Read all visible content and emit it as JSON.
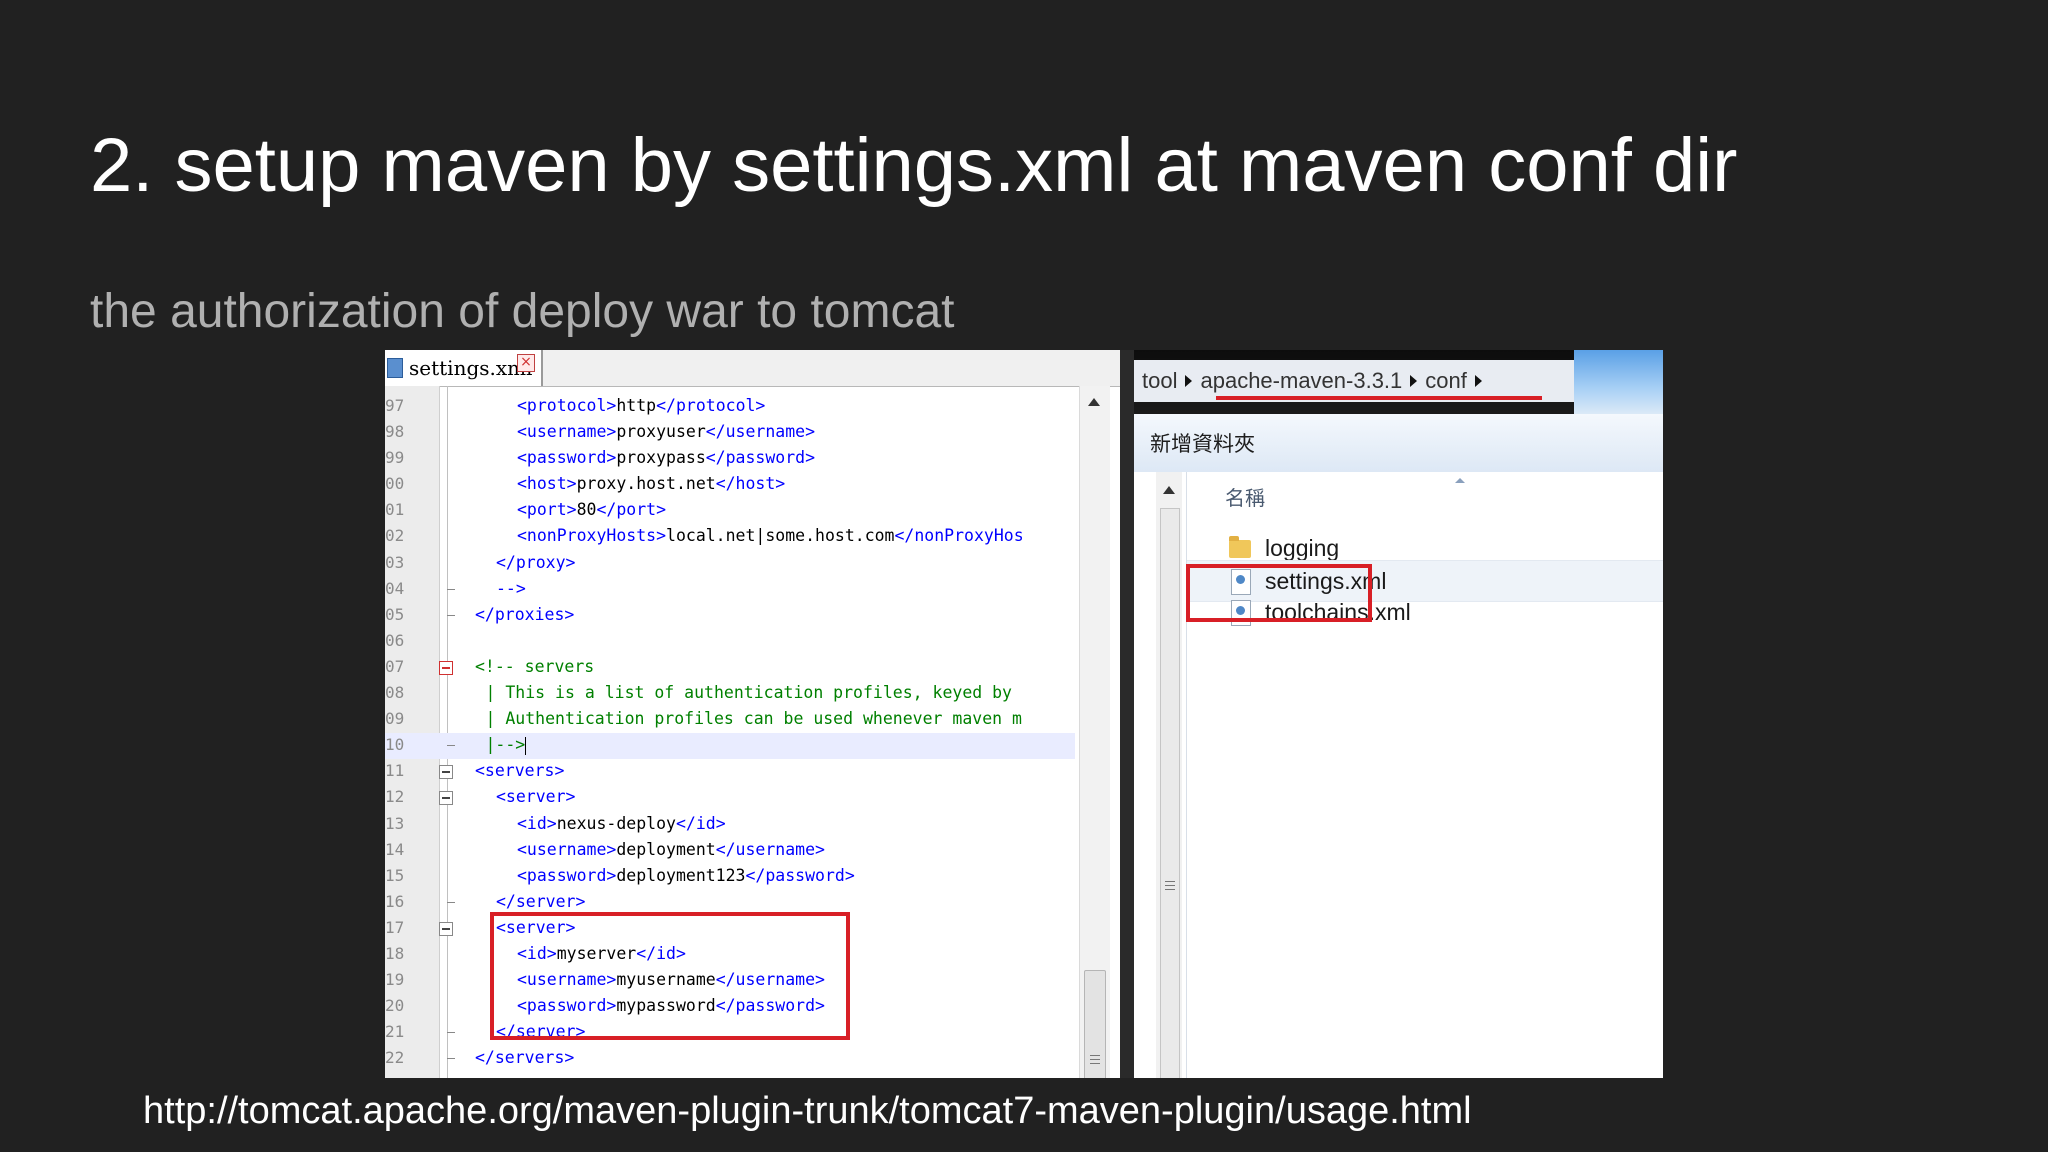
{
  "slide": {
    "title": "2. setup maven by settings.xml at maven conf dir",
    "subtitle": "the authorization of deploy war to tomcat",
    "footer_url": "http://tomcat.apache.org/maven-plugin-trunk/tomcat7-maven-plugin/usage.html"
  },
  "editor": {
    "tab_label": "settings.xml",
    "tab_close_glyph": "×",
    "lines": [
      {
        "ln": "97",
        "indent": 4,
        "segs": [
          [
            "tag",
            "<protocol>"
          ],
          [
            "val",
            "http"
          ],
          [
            "tag",
            "</protocol>"
          ]
        ]
      },
      {
        "ln": "98",
        "indent": 4,
        "segs": [
          [
            "tag",
            "<username>"
          ],
          [
            "val",
            "proxyuser"
          ],
          [
            "tag",
            "</username>"
          ]
        ]
      },
      {
        "ln": "99",
        "indent": 4,
        "segs": [
          [
            "tag",
            "<password>"
          ],
          [
            "val",
            "proxypass"
          ],
          [
            "tag",
            "</password>"
          ]
        ]
      },
      {
        "ln": "00",
        "indent": 4,
        "segs": [
          [
            "tag",
            "<host>"
          ],
          [
            "val",
            "proxy.host.net"
          ],
          [
            "tag",
            "</host>"
          ]
        ]
      },
      {
        "ln": "01",
        "indent": 4,
        "segs": [
          [
            "tag",
            "<port>"
          ],
          [
            "val",
            "80"
          ],
          [
            "tag",
            "</port>"
          ]
        ]
      },
      {
        "ln": "02",
        "indent": 4,
        "segs": [
          [
            "tag",
            "<nonProxyHosts>"
          ],
          [
            "val",
            "local.net|some.host.com"
          ],
          [
            "tag",
            "</nonProxyHos"
          ]
        ]
      },
      {
        "ln": "03",
        "indent": 2,
        "segs": [
          [
            "tag",
            "</proxy>"
          ]
        ]
      },
      {
        "ln": "04",
        "indent": 2,
        "segs": [
          [
            "tag",
            "-->"
          ]
        ],
        "fold": "end"
      },
      {
        "ln": "05",
        "indent": 0,
        "segs": [
          [
            "tag",
            "</proxies>"
          ]
        ],
        "fold": "end"
      },
      {
        "ln": "06",
        "indent": 0,
        "segs": []
      },
      {
        "ln": "07",
        "indent": 0,
        "segs": [
          [
            "cm",
            "<!-- servers"
          ]
        ],
        "fold": "box-red"
      },
      {
        "ln": "08",
        "indent": 1,
        "segs": [
          [
            "cm",
            "| This is a list of authentication profiles, keyed by"
          ]
        ]
      },
      {
        "ln": "09",
        "indent": 1,
        "segs": [
          [
            "cm",
            "| Authentication profiles can be used whenever maven m"
          ]
        ]
      },
      {
        "ln": "10",
        "indent": 1,
        "segs": [
          [
            "cm",
            "|-->"
          ]
        ],
        "fold": "end",
        "current": true
      },
      {
        "ln": "11",
        "indent": 0,
        "segs": [
          [
            "tag",
            "<servers>"
          ]
        ],
        "fold": "box"
      },
      {
        "ln": "12",
        "indent": 2,
        "segs": [
          [
            "tag",
            "<server>"
          ]
        ],
        "fold": "box"
      },
      {
        "ln": "13",
        "indent": 4,
        "segs": [
          [
            "tag",
            "<id>"
          ],
          [
            "val",
            "nexus-deploy"
          ],
          [
            "tag",
            "</id>"
          ]
        ]
      },
      {
        "ln": "14",
        "indent": 4,
        "segs": [
          [
            "tag",
            "<username>"
          ],
          [
            "val",
            "deployment"
          ],
          [
            "tag",
            "</username>"
          ]
        ]
      },
      {
        "ln": "15",
        "indent": 4,
        "segs": [
          [
            "tag",
            "<password>"
          ],
          [
            "val",
            "deployment123"
          ],
          [
            "tag",
            "</password>"
          ]
        ]
      },
      {
        "ln": "16",
        "indent": 2,
        "segs": [
          [
            "tag",
            "</server>"
          ]
        ],
        "fold": "end"
      },
      {
        "ln": "17",
        "indent": 2,
        "segs": [
          [
            "tag",
            "<server>"
          ]
        ],
        "fold": "box"
      },
      {
        "ln": "18",
        "indent": 4,
        "segs": [
          [
            "tag",
            "<id>"
          ],
          [
            "val",
            "myserver"
          ],
          [
            "tag",
            "</id>"
          ]
        ]
      },
      {
        "ln": "19",
        "indent": 4,
        "segs": [
          [
            "tag",
            "<username>"
          ],
          [
            "val",
            "myusername"
          ],
          [
            "tag",
            "</username>"
          ]
        ]
      },
      {
        "ln": "20",
        "indent": 4,
        "segs": [
          [
            "tag",
            "<password>"
          ],
          [
            "val",
            "mypassword"
          ],
          [
            "tag",
            "</password>"
          ]
        ]
      },
      {
        "ln": "21",
        "indent": 2,
        "segs": [
          [
            "tag",
            "</server>"
          ]
        ],
        "fold": "end"
      },
      {
        "ln": "22",
        "indent": 0,
        "segs": [
          [
            "tag",
            "</servers>"
          ]
        ],
        "fold": "end"
      }
    ]
  },
  "explorer": {
    "breadcrumb": [
      "tool",
      "apache-maven-3.3.1",
      "conf"
    ],
    "command_label": "新增資料夾",
    "column_header": "名稱",
    "files": [
      {
        "name": "logging",
        "kind": "folder"
      },
      {
        "name": "settings.xml",
        "kind": "xml",
        "selected": true
      },
      {
        "name": "toolchains.xml",
        "kind": "xml"
      }
    ]
  },
  "colors": {
    "background": "#212121",
    "highlight_red": "#d81f26",
    "xml_tag": "#0000ff",
    "xml_comment": "#008000"
  },
  "icons": {
    "tab_file": "xml-file-icon",
    "tab_close": "close-icon",
    "folder": "folder-icon",
    "xml_file": "xml-file-icon",
    "breadcrumb_separator": "chevron-right-icon"
  }
}
